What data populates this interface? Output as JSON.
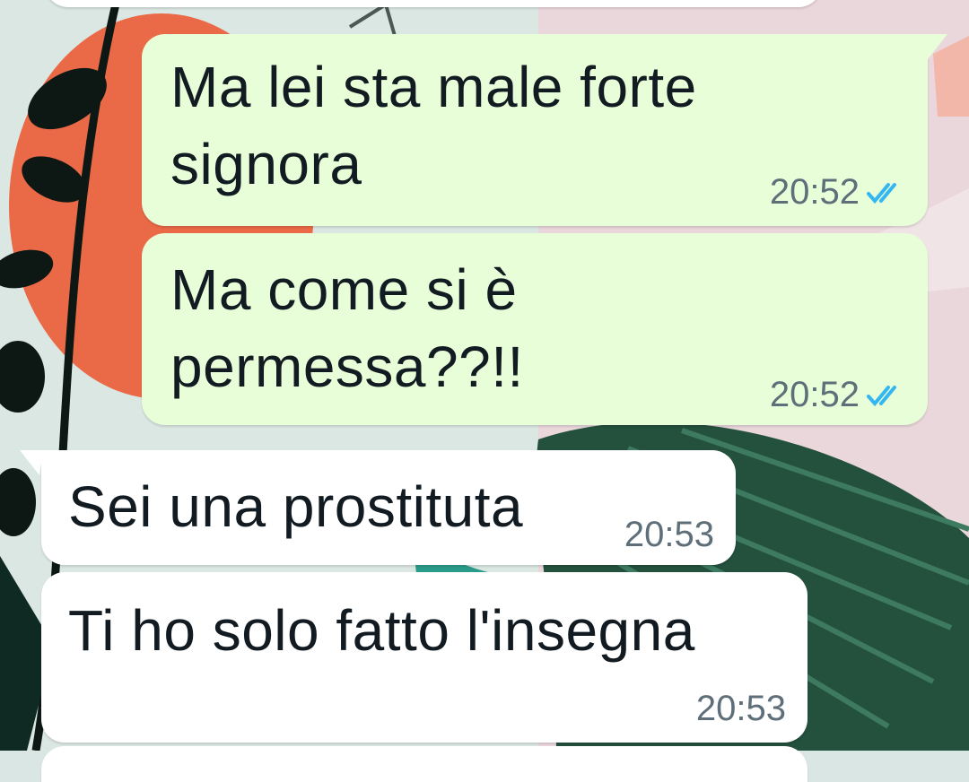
{
  "chat": {
    "messages": [
      {
        "direction": "outgoing",
        "lines": [
          "Ma lei sta male forte",
          "signora"
        ],
        "time": "20:52",
        "status": "read",
        "status_icon": "double-check-icon",
        "status_color": "#34b7f1"
      },
      {
        "direction": "outgoing",
        "lines": [
          "Ma come si è",
          "permessa??!!"
        ],
        "time": "20:52",
        "status": "read",
        "status_icon": "double-check-icon",
        "status_color": "#34b7f1"
      },
      {
        "direction": "incoming",
        "lines": [
          "Sei una prostituta"
        ],
        "time": "20:53"
      },
      {
        "direction": "incoming",
        "lines": [
          "Ti ho solo fatto l'insegna"
        ],
        "time": "20:53"
      }
    ]
  },
  "colors": {
    "outgoing_bubble": "#e7fed8",
    "incoming_bubble": "#ffffff",
    "text": "#111b21",
    "meta_text": "#5f6f7a",
    "read_ticks": "#34b7f1"
  }
}
